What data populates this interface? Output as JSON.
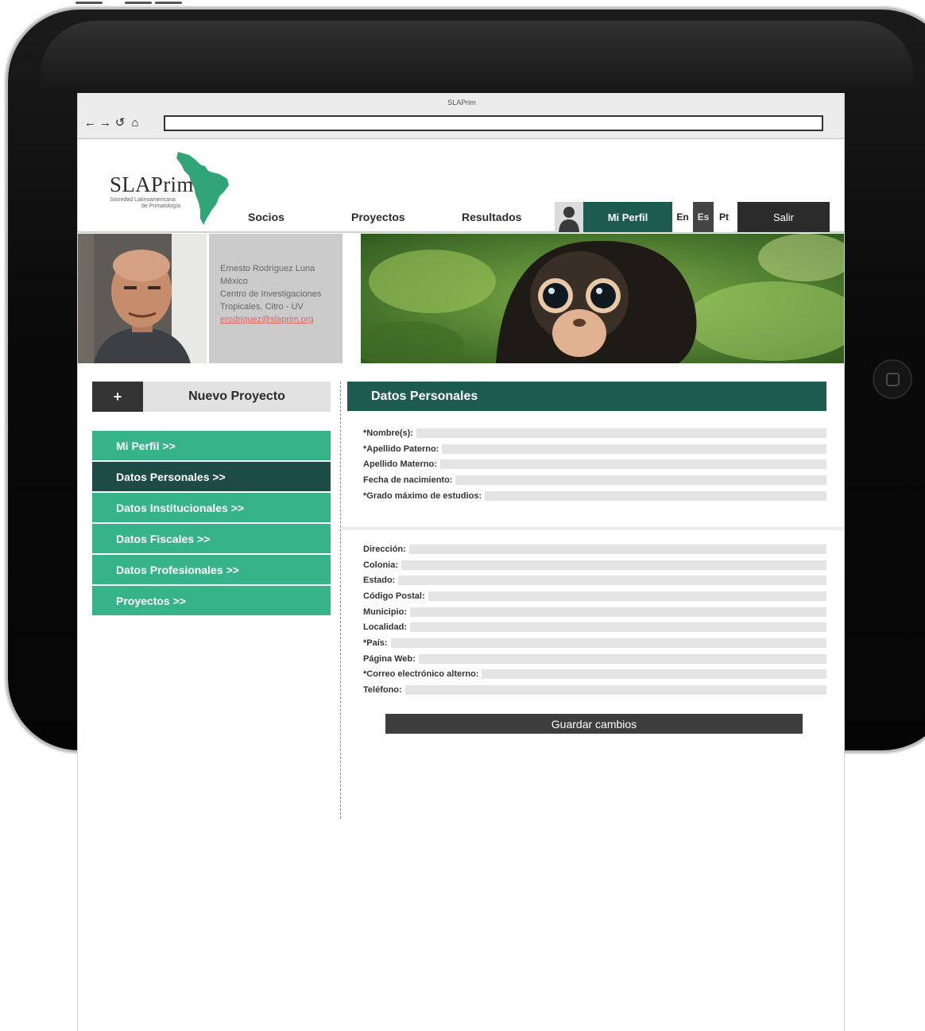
{
  "browser": {
    "window_title": "SLAPrim",
    "url": ""
  },
  "logo": {
    "name": "SLAPrim",
    "subtitle_1": "Sociedad Latinoamericana",
    "subtitle_2": "de Primatología"
  },
  "nav": {
    "items": [
      "Socios",
      "Proyectos",
      "Resultados"
    ],
    "profile_label": "Mi Perfil",
    "languages": [
      "En",
      "Es",
      "Pt"
    ],
    "active_language": "Es",
    "logout_label": "Salir"
  },
  "profile": {
    "name": "Ernesto Rodríguez Luna",
    "country": "México",
    "institution_1": "Centro de Investigaciones",
    "institution_2": "Tropicales, Citro - UV",
    "email": "erodriguez@slaprim.org"
  },
  "sidebar": {
    "new_project_icon": "+",
    "new_project_label": "Nuevo Proyecto",
    "menu": [
      "Mi Perfil >>",
      "Datos Personales >>",
      "Datos Institucionales >>",
      "Datos Fiscales >>",
      "Datos Profesionales >>",
      "Proyectos >>"
    ],
    "active_index": 1
  },
  "form": {
    "title": "Datos Personales",
    "personal_fields": [
      "*Nombre(s):",
      "*Apellido Paterno:",
      "Apellido Materno:",
      "Fecha de nacimiento:",
      "*Grado máximo de estudios:"
    ],
    "address_fields": [
      "Dirección:",
      "Colonia:",
      "Estado:",
      "Código Postal:",
      "Municipio:",
      "Localidad:",
      "*País:",
      "Página Web:",
      "*Correo electrónico alterno:",
      "Teléfono:"
    ],
    "save_label": "Guardar cambios"
  },
  "colors": {
    "dark_teal": "#1d5b50",
    "menu_green": "#37b389",
    "menu_active": "#1c4c45",
    "email_link": "#e0625c"
  },
  "icons": {
    "back": "arrow-left-icon",
    "forward": "arrow-right-icon",
    "reload": "reload-icon",
    "home": "home-icon",
    "user": "user-silhouette-icon"
  }
}
